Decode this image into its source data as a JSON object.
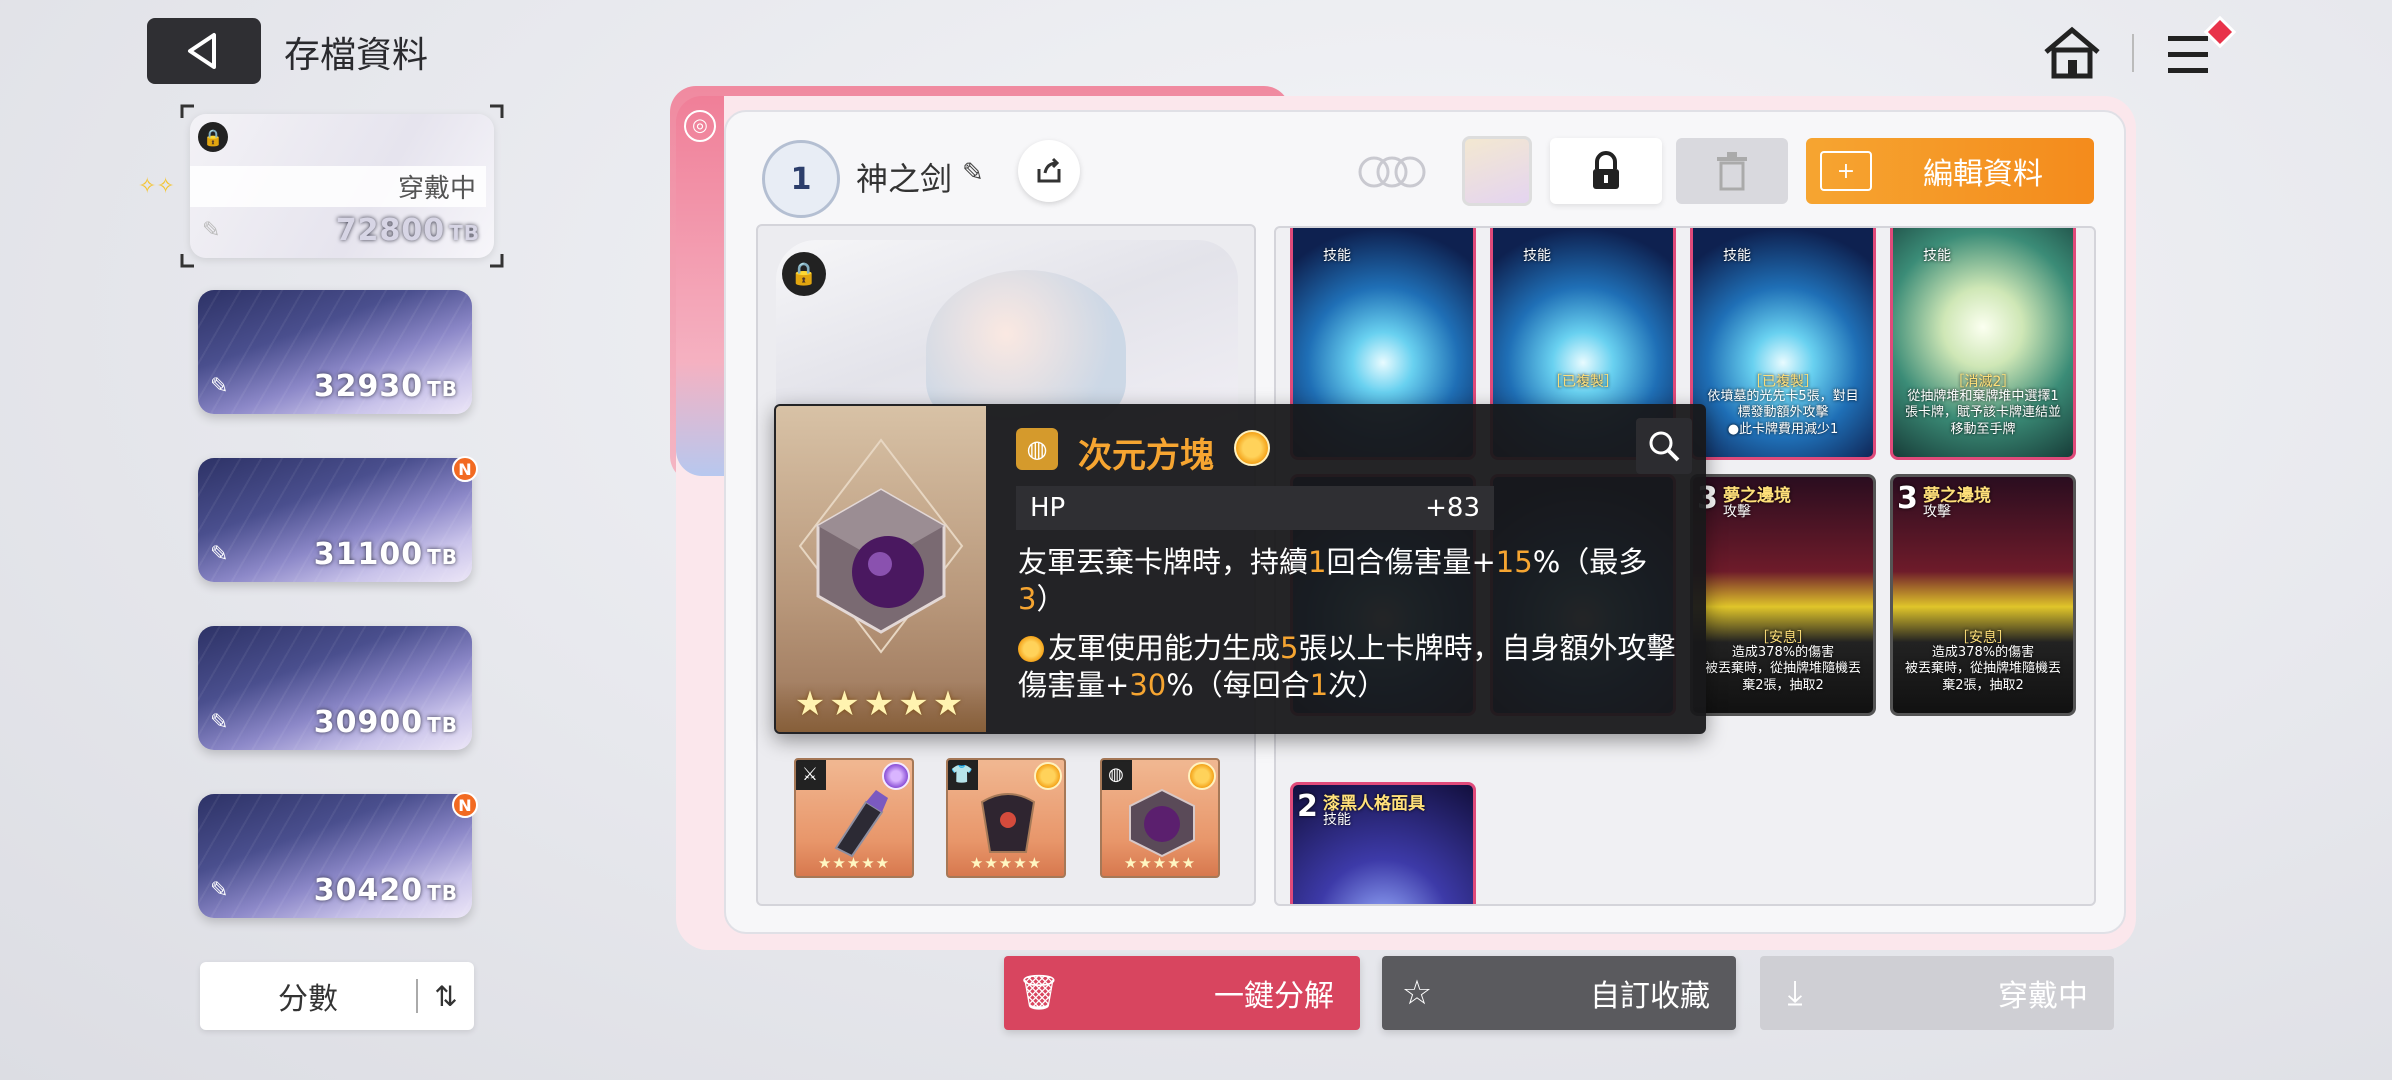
{
  "header": {
    "title": "存檔資料"
  },
  "saves": [
    {
      "score": "72800",
      "unit": "TB",
      "status": "穿戴中",
      "active": true
    },
    {
      "score": "32930",
      "unit": "TB",
      "badge": ""
    },
    {
      "score": "31100",
      "unit": "TB",
      "badge": "N"
    },
    {
      "score": "30900",
      "unit": "TB",
      "badge": ""
    },
    {
      "score": "30420",
      "unit": "TB",
      "badge": "N"
    }
  ],
  "sort": {
    "label": "分數"
  },
  "deck": {
    "level": "1",
    "name": "神之剑"
  },
  "actions": {
    "edit_data": "編輯資料"
  },
  "tooltip": {
    "name": "次元方塊",
    "stat_name": "HP",
    "stat_value": "+83",
    "desc1_a": "友軍丟棄卡牌時，持續",
    "desc1_b": "1",
    "desc1_c": "回合傷害量+",
    "desc1_d": "15",
    "desc1_e": "%（最多",
    "desc1_f": "3",
    "desc1_g": "）",
    "desc2_a": "友軍使用能力生成",
    "desc2_b": "5",
    "desc2_c": "張以上卡牌時，自身額外攻擊傷害量+",
    "desc2_d": "30",
    "desc2_e": "%（每回合",
    "desc2_f": "1",
    "desc2_g": "次）",
    "stars": "★★★★★"
  },
  "cards": [
    {
      "cost": "",
      "type": "技能",
      "tag": "",
      "desc": ""
    },
    {
      "cost": "",
      "type": "技能",
      "tag": "［已複製］",
      "desc": ""
    },
    {
      "cost": "",
      "type": "技能",
      "tag": "［已複製］",
      "desc": "依墳墓的光先卡5張，對目標發動額外攻擊\n●此卡牌費用減少1"
    },
    {
      "cost": "",
      "type": "技能",
      "tag": "［消滅2］",
      "desc": "從抽牌堆和棄牌堆中選擇1張卡牌，賦予該卡牌連結並移動至手牌"
    },
    {
      "cost": "3",
      "name": "夢之邊境",
      "type": "攻擊",
      "tag": "［安息］",
      "desc": "造成378%的傷害\n被丟棄時，從抽牌堆隨機丟棄2張，抽取2"
    },
    {
      "cost": "3",
      "name": "夢之邊境",
      "type": "攻擊",
      "tag": "［安息］",
      "desc": "造成378%的傷害\n被丟棄時，從抽牌堆隨機丟棄2張，抽取2"
    },
    {
      "cost": "2",
      "name": "漆黑人格面具",
      "type": "技能"
    }
  ],
  "equipment": {
    "stars": "★★★★★"
  },
  "bottom": {
    "disassemble": "一鍵分解",
    "collect": "自訂收藏",
    "wear": "穿戴中"
  },
  "colors": {
    "accent_orange": "#f6a531",
    "danger_red": "#d8455f",
    "badge_orange": "#f26a21"
  }
}
